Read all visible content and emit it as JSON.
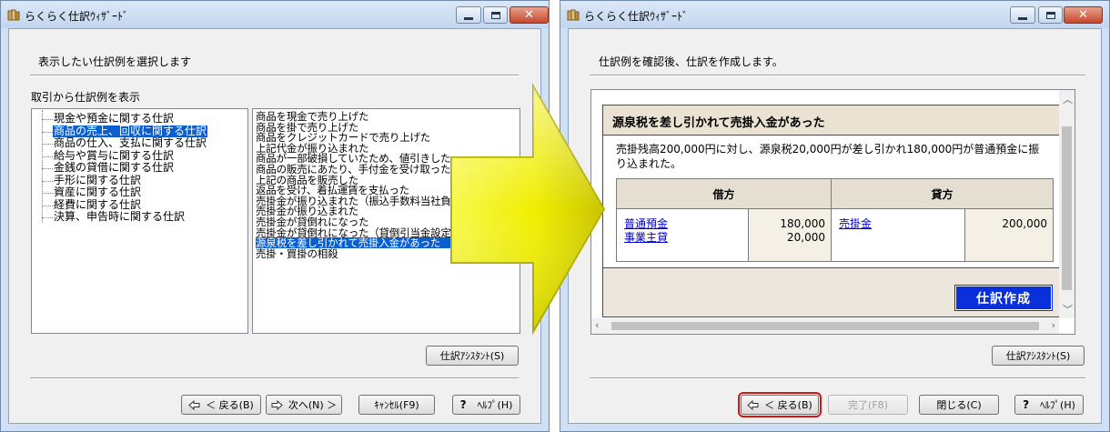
{
  "window1": {
    "title": "らくらく仕訳ｳｨｻﾞｰﾄﾞ",
    "heading": "表示したい仕訳例を選択します",
    "tree_caption": "取引から仕訳例を表示",
    "tree_items": [
      "現金や預金に関する仕訳",
      "商品の売上、回収に関する仕訳",
      "商品の仕入、支払に関する仕訳",
      "給与や賞与に関する仕訳",
      "金銭の貸借に関する仕訳",
      "手形に関する仕訳",
      "資産に関する仕訳",
      "経費に関する仕訳",
      "決算、申告時に関する仕訳"
    ],
    "tree_selected_index": 1,
    "list_items": [
      "商品を現金で売り上げた",
      "商品を掛で売り上げた",
      "商品をクレジットカードで売り上げた",
      "上記代金が振り込まれた",
      "商品が一部破損していたため、値引きした",
      "商品の販売にあたり、手付金を受け取った",
      "上記の商品を販売した",
      "返品を受け、着払運賃を支払った",
      "売掛金が振り込まれた（振込手数料当社負担）",
      "売掛金が振り込まれた",
      "売掛金が貸倒れになった",
      "売掛金が貸倒れになった（貸倒引当金設定済み）",
      "源泉税を差し引かれて売掛入金があった",
      "売掛・買掛の相殺"
    ],
    "list_selected_index": 12,
    "assistant_button": "仕訳ｱｼｽﾀﾝﾄ(S)",
    "buttons": {
      "back": "＜ 戻る(B)",
      "next": "次へ(N) ＞",
      "cancel": "ｷｬﾝｾﾙ(F9)",
      "help": "ﾍﾙﾌﾟ(H)"
    }
  },
  "window2": {
    "title": "らくらく仕訳ｳｨｻﾞｰﾄﾞ",
    "heading": "仕訳例を確認後、仕訳を作成します。",
    "example": {
      "title": "源泉税を差し引かれて売掛入金があった",
      "description": "売掛残高200,000円に対し、源泉税20,000円が差し引かれ180,000円が普通預金に振り込まれた。",
      "debit_header": "借方",
      "credit_header": "貸方",
      "debit_accounts": [
        "普通預金",
        "事業主貸"
      ],
      "debit_amounts": [
        "180,000",
        "20,000"
      ],
      "credit_accounts": [
        "売掛金"
      ],
      "credit_amounts": [
        "200,000"
      ],
      "create_button": "仕訳作成"
    },
    "assistant_button": "仕訳ｱｼｽﾀﾝﾄ(S)",
    "buttons": {
      "back": "＜ 戻る(B)",
      "finish": "完了(F8)",
      "close": "閉じる(C)",
      "help": "ﾍﾙﾌﾟ(H)"
    }
  },
  "colors": {
    "selection": "#0a5fcf",
    "arrow_yellow": "#f4f200",
    "focus_outline": "#d31515",
    "create_button": "#0b2fd8"
  }
}
